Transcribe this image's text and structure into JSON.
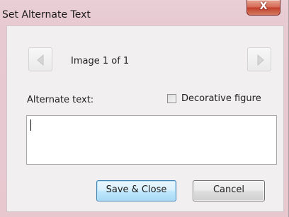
{
  "dialog": {
    "title": "Set Alternate Text",
    "close_label": "X"
  },
  "navigator": {
    "counter": "Image 1 of 1"
  },
  "alt_text": {
    "label": "Alternate text:",
    "value": "",
    "placeholder": ""
  },
  "decorative": {
    "label": "Decorative figure",
    "checked": false
  },
  "buttons": {
    "save_label": "Save & Close",
    "cancel_label": "Cancel"
  },
  "icons": {
    "previous": "arrow-left-icon",
    "next": "arrow-right-icon",
    "close": "close-icon"
  }
}
